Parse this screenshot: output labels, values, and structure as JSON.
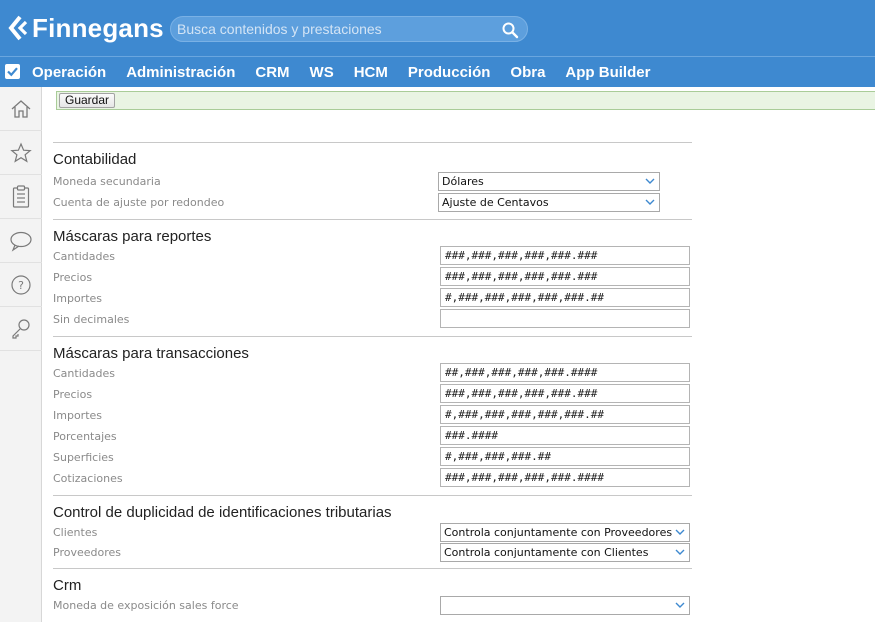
{
  "header": {
    "brand": "Finnegans",
    "search_placeholder": "Busca contenidos y prestaciones"
  },
  "menu": {
    "items": [
      {
        "label": "Operación"
      },
      {
        "label": "Administración"
      },
      {
        "label": "CRM"
      },
      {
        "label": "WS"
      },
      {
        "label": "HCM"
      },
      {
        "label": "Producción"
      },
      {
        "label": "Obra"
      },
      {
        "label": "App Builder"
      }
    ]
  },
  "sidebar": {
    "icons": [
      "home-icon",
      "star-icon",
      "clipboard-icon",
      "chat-icon",
      "help-icon",
      "key-icon"
    ]
  },
  "toolbar": {
    "save_label": "Guardar"
  },
  "sections": {
    "contabilidad": {
      "title": "Contabilidad",
      "moneda_secundaria": {
        "label": "Moneda secundaria",
        "value": "Dólares"
      },
      "cuenta_ajuste": {
        "label": "Cuenta de ajuste por redondeo",
        "value": "Ajuste de Centavos"
      }
    },
    "mascaras_reportes": {
      "title": "Máscaras para reportes",
      "cantidades": {
        "label": "Cantidades",
        "value": "###,###,###,###,###.###"
      },
      "precios": {
        "label": "Precios",
        "value": "###,###,###,###,###.###"
      },
      "importes": {
        "label": "Importes",
        "value": "#,###,###,###,###,###.##"
      },
      "sin_decimales": {
        "label": "Sin decimales",
        "value": ""
      }
    },
    "mascaras_transacciones": {
      "title": "Máscaras para transacciones",
      "cantidades": {
        "label": "Cantidades",
        "value": "##,###,###,###,###.####"
      },
      "precios": {
        "label": "Precios",
        "value": "###,###,###,###,###.###"
      },
      "importes": {
        "label": "Importes",
        "value": "#,###,###,###,###,###.##"
      },
      "porcentajes": {
        "label": "Porcentajes",
        "value": "###.####"
      },
      "superficies": {
        "label": "Superficies",
        "value": "#,###,###,###.##"
      },
      "cotizaciones": {
        "label": "Cotizaciones",
        "value": "###,###,###,###,###.####"
      }
    },
    "duplicidad": {
      "title": "Control de duplicidad de identificaciones tributarias",
      "clientes": {
        "label": "Clientes",
        "value": "Controla conjuntamente con Proveedores"
      },
      "proveedores": {
        "label": "Proveedores",
        "value": "Controla conjuntamente con Clientes"
      }
    },
    "crm": {
      "title": "Crm",
      "moneda_sales_force": {
        "label": "Moneda de exposición sales force",
        "value": ""
      }
    }
  },
  "colors": {
    "header_blue": "#3e89d0",
    "toolbar_green": "#e9f4e3",
    "label_gray": "#8a8a8a"
  }
}
